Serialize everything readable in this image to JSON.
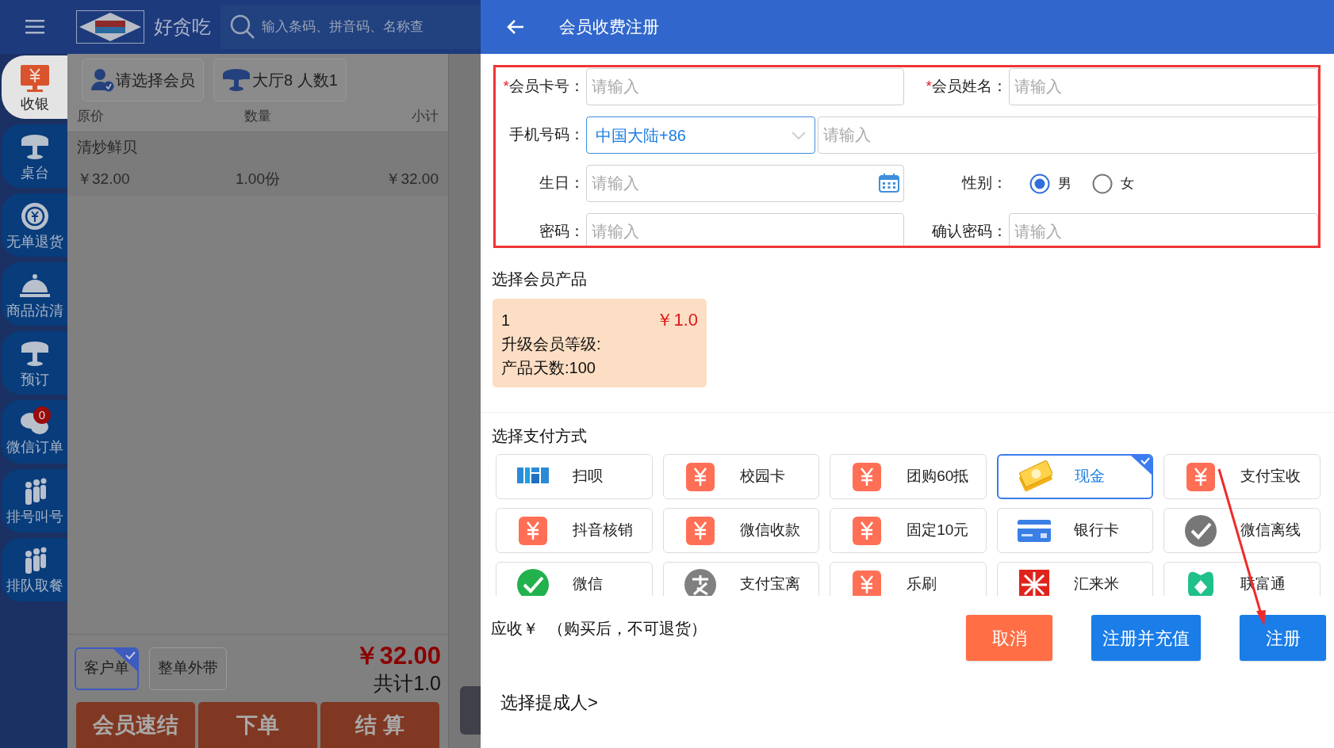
{
  "app": {
    "brand": "好贪吃",
    "search": {
      "placeholder": "输入条码、拼音码、名称查"
    },
    "sidebar": [
      {
        "label": "收银",
        "selected": true
      },
      {
        "label": "桌台",
        "selected": false
      },
      {
        "label": "无单退货",
        "selected": false
      },
      {
        "label": "商品沽清",
        "selected": false
      },
      {
        "label": "预订",
        "selected": false
      },
      {
        "label": "微信订单",
        "selected": false,
        "badge": "0"
      },
      {
        "label": "排号叫号",
        "selected": false
      },
      {
        "label": "排队取餐",
        "selected": false
      }
    ],
    "toolbar": [
      "请选择会员",
      "大厅8 人数1"
    ],
    "columns": [
      "原价",
      "数量",
      "小计"
    ],
    "rows": [
      {
        "name": "清炒鲜贝",
        "price": "￥32.00",
        "quantity": "1.00份",
        "subtotal": "￥32.00"
      }
    ],
    "order_types": [
      {
        "label": "客户单",
        "selected": true
      },
      {
        "label": "整单外带",
        "selected": false
      }
    ],
    "total": "￥32.00",
    "count": "共计1.0",
    "actions": [
      "会员速结",
      "下单",
      "结 算"
    ]
  },
  "dialog": {
    "title": "会员收费注册",
    "fields": [
      {
        "kind": "text",
        "required_mark": "*",
        "label": "会员卡号：",
        "placeholder": "请输入"
      },
      {
        "kind": "text",
        "required_mark": "*",
        "label": "会员姓名：",
        "placeholder": "请输入"
      },
      {
        "kind": "phone",
        "label": "手机号码：",
        "country": "中国大陆+86",
        "placeholder": "请输入"
      },
      {
        "kind": "date",
        "label": "生日：",
        "placeholder": "请输入"
      },
      {
        "kind": "radio",
        "label": "性别：",
        "options": [
          {
            "label": "男",
            "selected": true
          },
          {
            "label": "女",
            "selected": false
          }
        ]
      },
      {
        "kind": "text",
        "label": "密码：",
        "placeholder": "请输入"
      },
      {
        "kind": "text",
        "label": "确认密码：",
        "placeholder": "请输入"
      }
    ],
    "product_section": {
      "title": "选择会员产品",
      "products": [
        {
          "name": "1",
          "price": "￥1.0",
          "lines": [
            "升级会员等级:",
            "产品天数:100"
          ]
        }
      ]
    },
    "payment_section": {
      "title": "选择支付方式",
      "methods": [
        {
          "kind": "scan",
          "label": "扫呗",
          "selected": false
        },
        {
          "kind": "yuan",
          "label": "校园卡",
          "selected": false
        },
        {
          "kind": "yuan",
          "label": "团购60抵",
          "selected": false
        },
        {
          "kind": "cash",
          "label": "现金",
          "selected": true
        },
        {
          "kind": "yuan",
          "label": "支付宝收",
          "selected": false
        },
        {
          "kind": "yuan",
          "label": "抖音核销",
          "selected": false
        },
        {
          "kind": "yuan",
          "label": "微信收款",
          "selected": false
        },
        {
          "kind": "yuan",
          "label": "固定10元",
          "selected": false
        },
        {
          "kind": "card",
          "label": "银行卡",
          "selected": false
        },
        {
          "kind": "grey-check",
          "label": "微信离线",
          "selected": false
        },
        {
          "kind": "green-check",
          "label": "微信",
          "selected": false
        },
        {
          "kind": "grey-circle",
          "label": "支付宝离",
          "selected": false
        },
        {
          "kind": "yuan",
          "label": "乐刷",
          "selected": false
        },
        {
          "kind": "rice",
          "label": "汇来米",
          "selected": false
        },
        {
          "kind": "diamond",
          "label": "联富通",
          "selected": false
        }
      ]
    },
    "due_label": "应收￥",
    "due_note": "（购买后，不可退货）",
    "buttons": [
      {
        "kind": "cancel",
        "label": "取消"
      },
      {
        "kind": "primary",
        "label": "注册并充值"
      },
      {
        "kind": "primary",
        "label": "注册"
      }
    ],
    "commission": "选择提成人>"
  }
}
